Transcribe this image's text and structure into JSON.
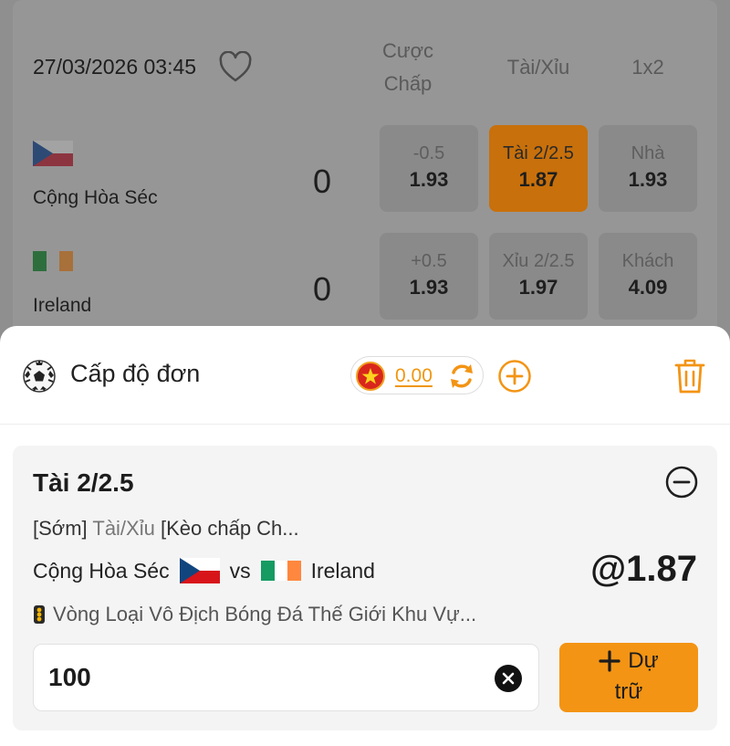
{
  "match": {
    "datetime": "27/03/2026 03:45",
    "columns": {
      "handicap_l1": "Cược",
      "handicap_l2": "Chấp",
      "over_under": "Tài/Xỉu",
      "one_x_two": "1x2"
    },
    "home": {
      "name": "Cộng Hòa Séc",
      "score": "0",
      "odds": [
        {
          "label": "-0.5",
          "value": "1.93"
        },
        {
          "label": "Tài 2/2.5",
          "value": "1.87"
        },
        {
          "label": "Nhà",
          "value": "1.93"
        }
      ]
    },
    "away": {
      "name": "Ireland",
      "score": "0",
      "odds": [
        {
          "label": "+0.5",
          "value": "1.93"
        },
        {
          "label": "Xỉu 2/2.5",
          "value": "1.97"
        },
        {
          "label": "Khách",
          "value": "4.09"
        }
      ]
    }
  },
  "slip": {
    "title": "Cấp độ đơn",
    "balance": "0.00",
    "bet": {
      "selection": "Tài 2/2.5",
      "meta_tag": "[Sớm]",
      "meta_market": "Tài/Xỉu",
      "meta_extra": "[Kèo chấp Ch...",
      "home": "Cộng Hòa Séc",
      "vs": "vs",
      "away": "Ireland",
      "odds": "@1.87",
      "league": "Vòng Loại Vô Địch Bóng Đá Thế Giới Khu Vự..."
    },
    "stake_value": "100",
    "reserve_l1": "Dự",
    "reserve_l2": "trữ"
  },
  "colors": {
    "accent": "#f39414",
    "selected_odds": "#c8700b",
    "overlay": "#8f8f8f"
  },
  "icons": [
    "heart-icon",
    "czech-flag-icon",
    "ireland-flag-icon",
    "soccer-ball-icon",
    "vietnam-flag-icon",
    "refresh-icon",
    "add-circle-icon",
    "trash-icon",
    "remove-circle-icon",
    "trophy-icon",
    "clear-icon",
    "plus-icon"
  ]
}
